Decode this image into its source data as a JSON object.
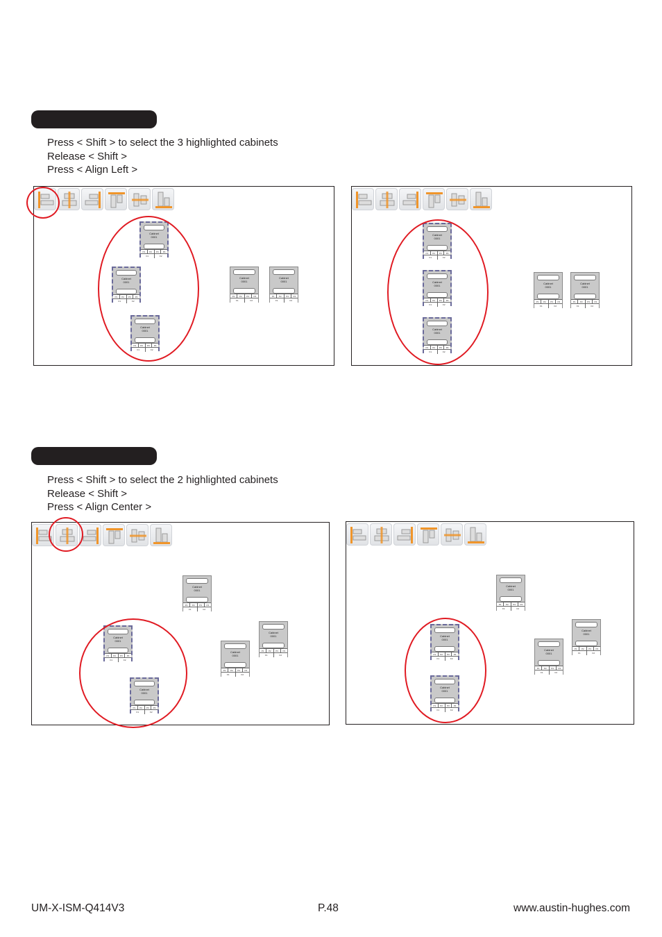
{
  "section1": {
    "steps": [
      "Press < Shift > to select the 3 highlighted cabinets",
      "Release < Shift >",
      "Press < Align Left >"
    ],
    "highlighted_tool": "align-left",
    "selected_count": 3
  },
  "section2": {
    "steps": [
      "Press < Shift > to select the 2 highlighted cabinets",
      "Release < Shift >",
      "Press < Align Center >"
    ],
    "highlighted_tool": "align-center",
    "selected_count": 2
  },
  "toolbar": {
    "tools": [
      {
        "name": "align-left",
        "icon": "align-left-icon"
      },
      {
        "name": "align-center",
        "icon": "align-center-icon"
      },
      {
        "name": "align-right",
        "icon": "align-right-icon"
      },
      {
        "name": "align-top",
        "icon": "align-top-icon"
      },
      {
        "name": "align-middle",
        "icon": "align-middle-icon"
      },
      {
        "name": "align-bottom",
        "icon": "align-bottom-icon"
      }
    ]
  },
  "cabinet": {
    "name": "Cabinet",
    "id": "0001",
    "ports": [
      "P1",
      "P2",
      "P3",
      "P4"
    ],
    "feeds": [
      "F1",
      "F2"
    ]
  },
  "colors": {
    "accent": "#f0952a",
    "highlight_ring": "#e01a22",
    "cabinet_fill": "#c9c9c9",
    "selection_border": "#6a6a9a"
  },
  "footer": {
    "doc_id": "UM-X-ISM-Q414V3",
    "page": "P.48",
    "website": "www.austin-hughes.com"
  }
}
